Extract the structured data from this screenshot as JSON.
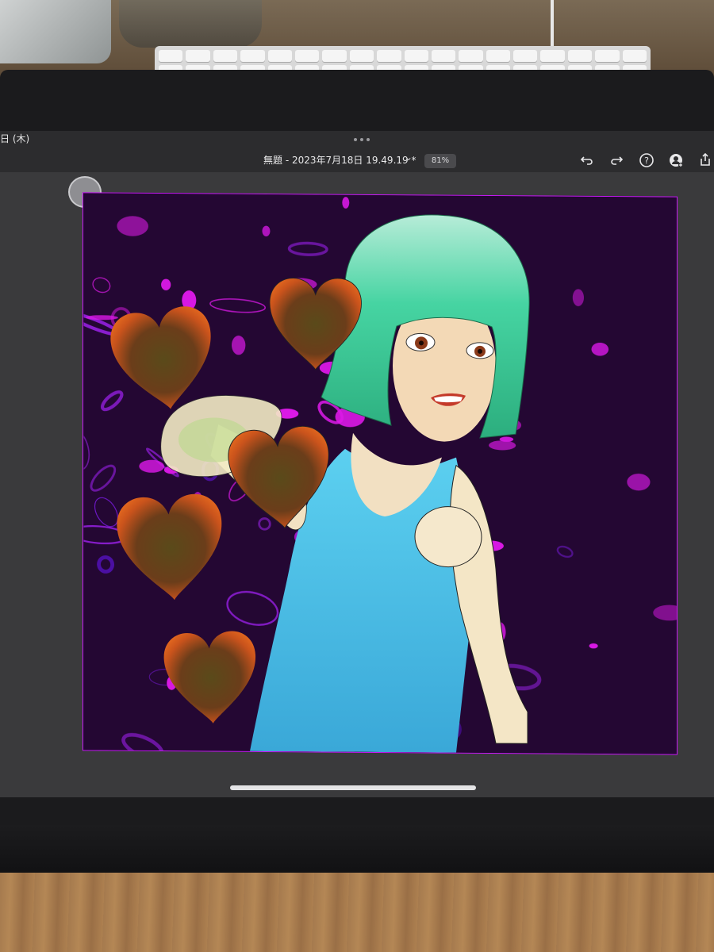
{
  "status_bar": {
    "date_fragment": "日 (木)"
  },
  "toolbar": {
    "document_title": "無題 - 2023年7月18日 19.49.19 *",
    "zoom_level": "81%",
    "icons": [
      "chevron-down-icon",
      "undo-icon",
      "redo-icon",
      "help-icon",
      "user-add-icon",
      "share-icon"
    ]
  },
  "colors": {
    "app_background": "#3a3a3c",
    "toolbar_background": "#2c2c2e",
    "canvas_border": "#c61af4",
    "art_purple": "#7a1ae0",
    "art_magenta": "#e41af0",
    "hair_green": "#3ccf9a",
    "dress_blue": "#4ec2e6",
    "heart_orange": "#d85a1e"
  }
}
